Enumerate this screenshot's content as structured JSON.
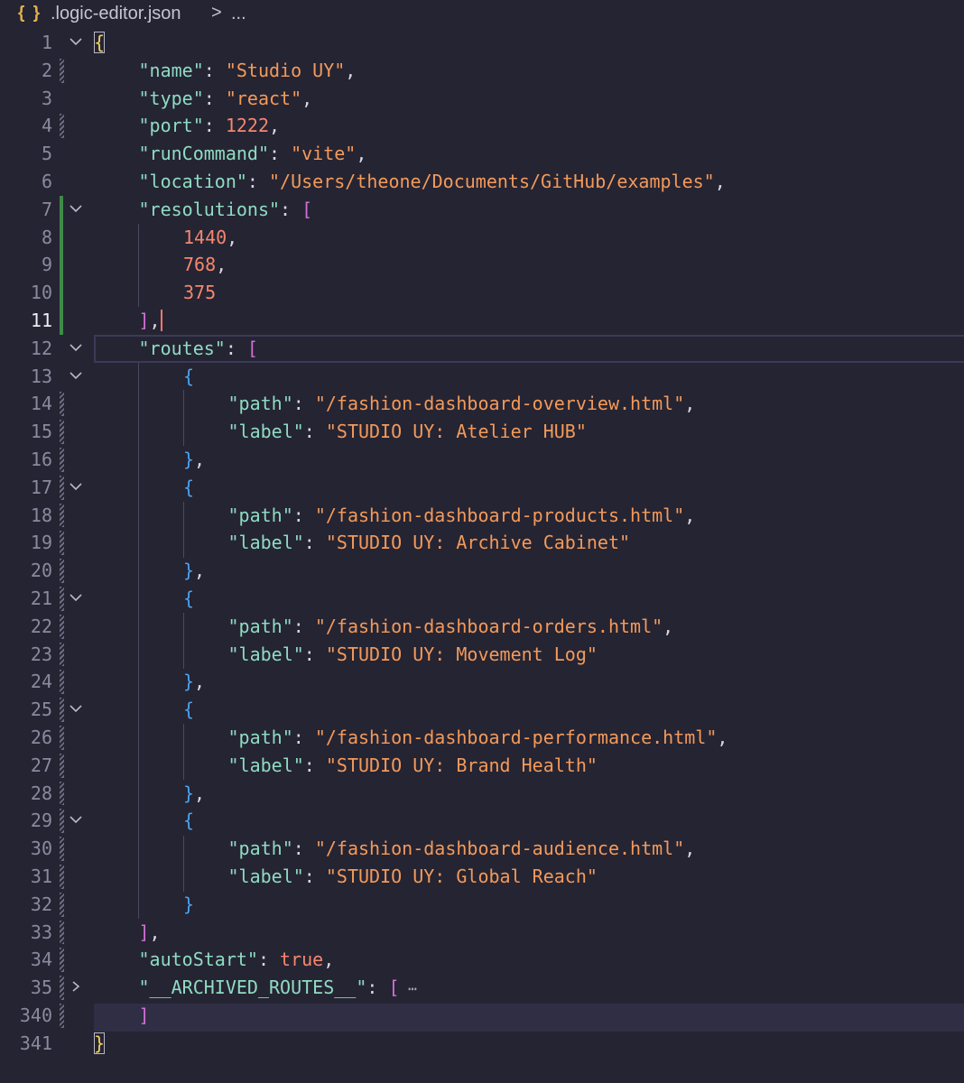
{
  "breadcrumb": {
    "icon": "{ }",
    "file": ".logic-editor.json",
    "separator": ">",
    "more": "..."
  },
  "lines": [
    {
      "n": "1",
      "fold": "v",
      "mark": "",
      "ind": 0,
      "seg": [
        [
          "br1",
          "{"
        ]
      ]
    },
    {
      "n": "2",
      "fold": "",
      "mark": "hatch",
      "ind": 1,
      "seg": [
        [
          "k",
          "\"name\""
        ],
        [
          "p",
          ": "
        ],
        [
          "s",
          "\"Studio UY\""
        ],
        [
          "p",
          ","
        ]
      ]
    },
    {
      "n": "3",
      "fold": "",
      "mark": "",
      "ind": 1,
      "seg": [
        [
          "k",
          "\"type\""
        ],
        [
          "p",
          ": "
        ],
        [
          "s",
          "\"react\""
        ],
        [
          "p",
          ","
        ]
      ]
    },
    {
      "n": "4",
      "fold": "",
      "mark": "hatch",
      "ind": 1,
      "seg": [
        [
          "k",
          "\"port\""
        ],
        [
          "p",
          ": "
        ],
        [
          "n",
          "1222"
        ],
        [
          "p",
          ","
        ]
      ]
    },
    {
      "n": "5",
      "fold": "",
      "mark": "",
      "ind": 1,
      "seg": [
        [
          "k",
          "\"runCommand\""
        ],
        [
          "p",
          ": "
        ],
        [
          "s",
          "\"vite\""
        ],
        [
          "p",
          ","
        ]
      ]
    },
    {
      "n": "6",
      "fold": "",
      "mark": "",
      "ind": 1,
      "seg": [
        [
          "k",
          "\"location\""
        ],
        [
          "p",
          ": "
        ],
        [
          "s",
          "\"/Users/theone/Documents/GitHub/examples\""
        ],
        [
          "p",
          ","
        ]
      ]
    },
    {
      "n": "7",
      "fold": "v",
      "mark": "added",
      "ind": 1,
      "seg": [
        [
          "k",
          "\"resolutions\""
        ],
        [
          "p",
          ": "
        ],
        [
          "br2",
          "["
        ]
      ]
    },
    {
      "n": "8",
      "fold": "",
      "mark": "added",
      "ind": 2,
      "seg": [
        [
          "n",
          "1440"
        ],
        [
          "p",
          ","
        ]
      ]
    },
    {
      "n": "9",
      "fold": "",
      "mark": "added",
      "ind": 2,
      "seg": [
        [
          "n",
          "768"
        ],
        [
          "p",
          ","
        ]
      ]
    },
    {
      "n": "10",
      "fold": "",
      "mark": "added",
      "ind": 2,
      "seg": [
        [
          "n",
          "375"
        ]
      ]
    },
    {
      "n": "11",
      "fold": "",
      "mark": "added",
      "ind": 1,
      "active": true,
      "seg": [
        [
          "br2",
          "]"
        ],
        [
          "p",
          ","
        ]
      ]
    },
    {
      "n": "12",
      "fold": "v",
      "mark": "",
      "ind": 1,
      "seg": [
        [
          "k",
          "\"routes\""
        ],
        [
          "p",
          ": "
        ],
        [
          "br2",
          "["
        ]
      ]
    },
    {
      "n": "13",
      "fold": "v",
      "mark": "",
      "ind": 2,
      "seg": [
        [
          "br3",
          "{"
        ]
      ]
    },
    {
      "n": "14",
      "fold": "",
      "mark": "hatch",
      "ind": 3,
      "seg": [
        [
          "k",
          "\"path\""
        ],
        [
          "p",
          ": "
        ],
        [
          "s",
          "\"/fashion-dashboard-overview.html\""
        ],
        [
          "p",
          ","
        ]
      ]
    },
    {
      "n": "15",
      "fold": "",
      "mark": "hatch",
      "ind": 3,
      "seg": [
        [
          "k",
          "\"label\""
        ],
        [
          "p",
          ": "
        ],
        [
          "s",
          "\"STUDIO UY: Atelier HUB\""
        ]
      ]
    },
    {
      "n": "16",
      "fold": "",
      "mark": "hatch",
      "ind": 2,
      "seg": [
        [
          "br3",
          "}"
        ],
        [
          "p",
          ","
        ]
      ]
    },
    {
      "n": "17",
      "fold": "v",
      "mark": "hatch",
      "ind": 2,
      "seg": [
        [
          "br3",
          "{"
        ]
      ]
    },
    {
      "n": "18",
      "fold": "",
      "mark": "hatch",
      "ind": 3,
      "seg": [
        [
          "k",
          "\"path\""
        ],
        [
          "p",
          ": "
        ],
        [
          "s",
          "\"/fashion-dashboard-products.html\""
        ],
        [
          "p",
          ","
        ]
      ]
    },
    {
      "n": "19",
      "fold": "",
      "mark": "hatch",
      "ind": 3,
      "seg": [
        [
          "k",
          "\"label\""
        ],
        [
          "p",
          ": "
        ],
        [
          "s",
          "\"STUDIO UY: Archive Cabinet\""
        ]
      ]
    },
    {
      "n": "20",
      "fold": "",
      "mark": "hatch",
      "ind": 2,
      "seg": [
        [
          "br3",
          "}"
        ],
        [
          "p",
          ","
        ]
      ]
    },
    {
      "n": "21",
      "fold": "v",
      "mark": "hatch",
      "ind": 2,
      "seg": [
        [
          "br3",
          "{"
        ]
      ]
    },
    {
      "n": "22",
      "fold": "",
      "mark": "hatch",
      "ind": 3,
      "seg": [
        [
          "k",
          "\"path\""
        ],
        [
          "p",
          ": "
        ],
        [
          "s",
          "\"/fashion-dashboard-orders.html\""
        ],
        [
          "p",
          ","
        ]
      ]
    },
    {
      "n": "23",
      "fold": "",
      "mark": "hatch",
      "ind": 3,
      "seg": [
        [
          "k",
          "\"label\""
        ],
        [
          "p",
          ": "
        ],
        [
          "s",
          "\"STUDIO UY: Movement Log\""
        ]
      ]
    },
    {
      "n": "24",
      "fold": "",
      "mark": "hatch",
      "ind": 2,
      "seg": [
        [
          "br3",
          "}"
        ],
        [
          "p",
          ","
        ]
      ]
    },
    {
      "n": "25",
      "fold": "v",
      "mark": "hatch",
      "ind": 2,
      "seg": [
        [
          "br3",
          "{"
        ]
      ]
    },
    {
      "n": "26",
      "fold": "",
      "mark": "hatch",
      "ind": 3,
      "seg": [
        [
          "k",
          "\"path\""
        ],
        [
          "p",
          ": "
        ],
        [
          "s",
          "\"/fashion-dashboard-performance.html\""
        ],
        [
          "p",
          ","
        ]
      ]
    },
    {
      "n": "27",
      "fold": "",
      "mark": "hatch",
      "ind": 3,
      "seg": [
        [
          "k",
          "\"label\""
        ],
        [
          "p",
          ": "
        ],
        [
          "s",
          "\"STUDIO UY: Brand Health\""
        ]
      ]
    },
    {
      "n": "28",
      "fold": "",
      "mark": "hatch",
      "ind": 2,
      "seg": [
        [
          "br3",
          "}"
        ],
        [
          "p",
          ","
        ]
      ]
    },
    {
      "n": "29",
      "fold": "v",
      "mark": "hatch",
      "ind": 2,
      "seg": [
        [
          "br3",
          "{"
        ]
      ]
    },
    {
      "n": "30",
      "fold": "",
      "mark": "hatch",
      "ind": 3,
      "seg": [
        [
          "k",
          "\"path\""
        ],
        [
          "p",
          ": "
        ],
        [
          "s",
          "\"/fashion-dashboard-audience.html\""
        ],
        [
          "p",
          ","
        ]
      ]
    },
    {
      "n": "31",
      "fold": "",
      "mark": "hatch",
      "ind": 3,
      "seg": [
        [
          "k",
          "\"label\""
        ],
        [
          "p",
          ": "
        ],
        [
          "s",
          "\"STUDIO UY: Global Reach\""
        ]
      ]
    },
    {
      "n": "32",
      "fold": "",
      "mark": "hatch",
      "ind": 2,
      "seg": [
        [
          "br3",
          "}"
        ]
      ]
    },
    {
      "n": "33",
      "fold": "",
      "mark": "hatch",
      "ind": 1,
      "seg": [
        [
          "br2",
          "]"
        ],
        [
          "p",
          ","
        ]
      ]
    },
    {
      "n": "34",
      "fold": "",
      "mark": "hatch",
      "ind": 1,
      "seg": [
        [
          "k",
          "\"autoStart\""
        ],
        [
          "p",
          ": "
        ],
        [
          "b",
          "true"
        ],
        [
          "p",
          ","
        ]
      ]
    },
    {
      "n": "35",
      "fold": ">",
      "mark": "hatch",
      "ind": 1,
      "seg": [
        [
          "k",
          "\"__ARCHIVED_ROUTES__\""
        ],
        [
          "p",
          ": "
        ],
        [
          "br2",
          "["
        ],
        [
          "ell",
          " ⋯"
        ]
      ]
    },
    {
      "n": "340",
      "fold": "",
      "mark": "hatch",
      "ind": 1,
      "seg": [
        [
          "br2",
          "]"
        ]
      ]
    },
    {
      "n": "341",
      "fold": "",
      "mark": "",
      "ind": 0,
      "seg": [
        [
          "br1",
          "}"
        ]
      ]
    }
  ],
  "colors": {
    "background": "#252433",
    "key": "#8fdcc2",
    "string": "#f39a5a",
    "number": "#f5876e",
    "bracket_outer": "#f0d35a",
    "bracket_array": "#d16fd6",
    "bracket_object": "#4aa3f0",
    "git_added": "#3f8a4a"
  }
}
